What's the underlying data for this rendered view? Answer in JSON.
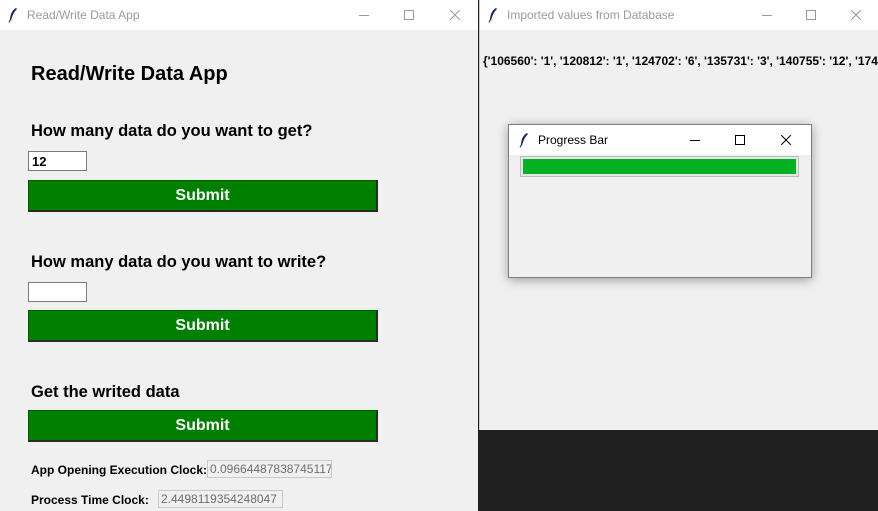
{
  "main_window": {
    "title": "Read/Write Data App",
    "heading": "Read/Write Data App",
    "get_question": "How many data do you want to get?",
    "get_value": "12",
    "get_submit": "Submit",
    "write_question": "How many data do you want to write?",
    "write_value": "",
    "write_submit": "Submit",
    "writed_label": "Get the writed data",
    "writed_submit": "Submit",
    "opening_clock_label": "App Opening Execution Clock:",
    "opening_clock_value": "0.09664487838745117",
    "process_clock_label": "Process Time Clock:",
    "process_clock_value": "2.4498119354248047"
  },
  "db_window": {
    "title": "Imported values from Database",
    "content": "{'106560': '1', '120812': '1', '124702': '6', '135731': '3', '140755': '12', '174"
  },
  "progress_window": {
    "title": "Progress Bar",
    "progress_fraction": 1.0
  },
  "colors": {
    "button_green": "#008000",
    "progress_green": "#06b025"
  },
  "icons": [
    "feather-icon",
    "minimize-icon",
    "maximize-icon",
    "close-icon"
  ]
}
